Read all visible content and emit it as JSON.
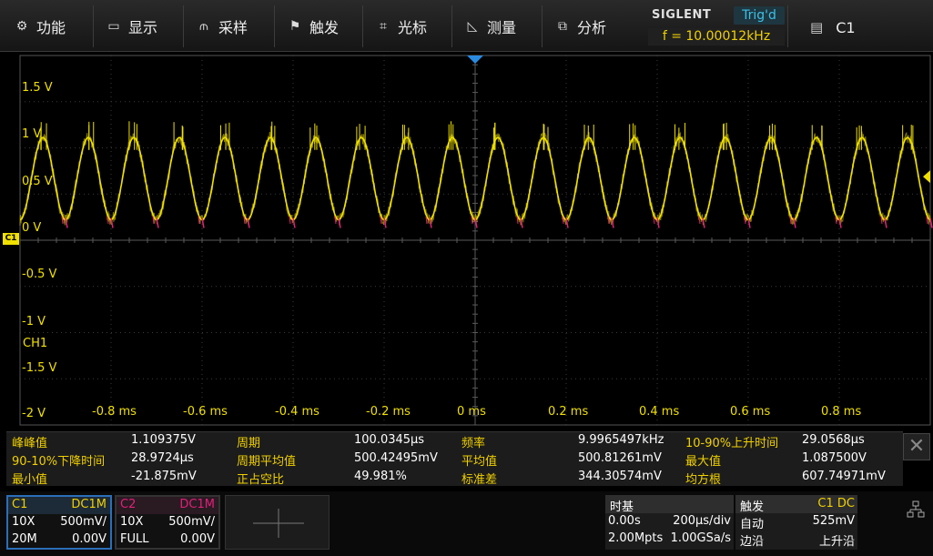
{
  "menu": {
    "items": [
      {
        "label": "功能",
        "icon": "gear-icon",
        "glyph": "⚙"
      },
      {
        "label": "显示",
        "icon": "monitor-icon",
        "glyph": "▭"
      },
      {
        "label": "采样",
        "icon": "sample-icon",
        "glyph": "⫙"
      },
      {
        "label": "触发",
        "icon": "flag-icon",
        "glyph": "⚑"
      },
      {
        "label": "光标",
        "icon": "cursor-grid-icon",
        "glyph": "⌗"
      },
      {
        "label": "测量",
        "icon": "measure-icon",
        "glyph": "◺"
      },
      {
        "label": "分析",
        "icon": "analysis-icon",
        "glyph": "⧉"
      }
    ],
    "brand": "SIGLENT",
    "trigger_status": "Trig'd",
    "frequency": "f = 10.00012kHz",
    "channel_select": "C1"
  },
  "screen": {
    "y_labels": [
      "1.5 V",
      "1 V",
      "0.5 V",
      "0 V",
      "-0.5 V",
      "-1 V",
      "-1.5 V",
      "-2 V"
    ],
    "x_labels": [
      "-0.8 ms",
      "-0.6 ms",
      "-0.4 ms",
      "-0.2 ms",
      "0 ms",
      "0.2 ms",
      "0.4 ms",
      "0.6 ms",
      "0.8 ms"
    ],
    "channel_tag": "C1",
    "channel_name": "CH1",
    "colors": {
      "trace": "#f0e000",
      "glitch": "#e0207a",
      "grid": "#3a3a3a",
      "center": "#5a5a5a",
      "trigger": "#2a8ae0"
    }
  },
  "waveform": {
    "frequency_khz": 10.00012,
    "amplitude_v": 0.5,
    "offset_v": 0.5,
    "time_range_ms": [
      -1.0,
      1.0
    ],
    "volt_range": [
      -2.5,
      2.0
    ]
  },
  "measurements": {
    "rows": [
      [
        {
          "label": "峰峰值",
          "value": "1.109375V"
        },
        {
          "label": "周期",
          "value": "100.0345μs"
        },
        {
          "label": "频率",
          "value": "9.9965497kHz"
        },
        {
          "label": "10-90%上升时间",
          "value": "29.0568μs"
        }
      ],
      [
        {
          "label": "90-10%下降时间",
          "value": "28.9724μs"
        },
        {
          "label": "周期平均值",
          "value": "500.42495mV"
        },
        {
          "label": "平均值",
          "value": "500.81261mV"
        },
        {
          "label": "最大值",
          "value": "1.087500V"
        }
      ],
      [
        {
          "label": "最小值",
          "value": "-21.875mV"
        },
        {
          "label": "正占空比",
          "value": "49.981%"
        },
        {
          "label": "标准差",
          "value": "344.30574mV"
        },
        {
          "label": "均方根",
          "value": "607.74971mV"
        }
      ]
    ],
    "close_glyph": "✕"
  },
  "channels": [
    {
      "name": "C1",
      "coupling": "DC1M",
      "probe": "10X",
      "scale": "500mV/",
      "bandwidth": "20M",
      "offset": "0.00V",
      "color": "#f0d000"
    },
    {
      "name": "C2",
      "coupling": "DC1M",
      "probe": "10X",
      "scale": "500mV/",
      "bandwidth": "FULL",
      "offset": "0.00V",
      "color": "#e0207a"
    }
  ],
  "timebase": {
    "title": "时基",
    "delay": "0.00s",
    "scale": "200μs/div",
    "memory": "2.00Mpts",
    "sample_rate": "1.00GSa/s"
  },
  "trigger": {
    "title": "触发",
    "source": "C1 DC",
    "mode": "自动",
    "level": "525mV",
    "type": "边沿",
    "slope": "上升沿"
  }
}
